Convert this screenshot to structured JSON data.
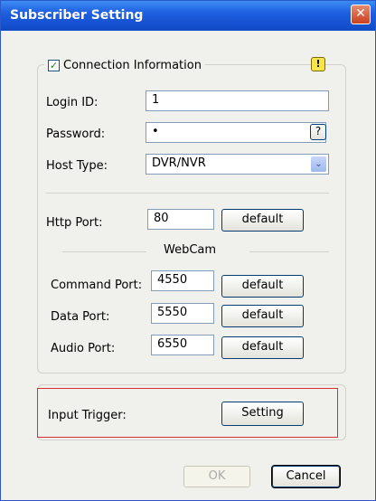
{
  "window": {
    "title": "Subscriber Setting",
    "close_symbol": "✕"
  },
  "connection": {
    "checkbox_label": "Connection Information",
    "checked": true,
    "warn_symbol": "!"
  },
  "login": {
    "label": "Login ID:",
    "value": "1"
  },
  "password": {
    "label": "Password:",
    "value": "•",
    "help_label": "?"
  },
  "host_type": {
    "label": "Host Type:",
    "value": "DVR/NVR",
    "arrow": "⌄"
  },
  "http_port": {
    "label": "Http Port:",
    "value": "80",
    "button": "default"
  },
  "webcam": {
    "heading": "WebCam"
  },
  "command_port": {
    "label": "Command Port:",
    "value": "4550",
    "button": "default"
  },
  "data_port": {
    "label": "Data Port:",
    "value": "5550",
    "button": "default"
  },
  "audio_port": {
    "label": "Audio Port:",
    "value": "6550",
    "button": "default"
  },
  "input_trigger": {
    "label": "Input Trigger:",
    "button": "Setting"
  },
  "footer": {
    "ok_label": "OK",
    "cancel_label": "Cancel"
  }
}
